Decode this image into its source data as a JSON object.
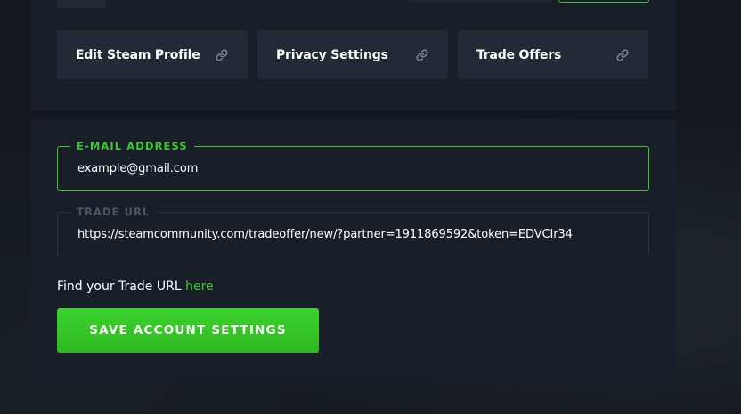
{
  "links": [
    {
      "label": "Edit Steam Profile",
      "icon": "link-icon"
    },
    {
      "label": "Privacy Settings",
      "icon": "link-icon"
    },
    {
      "label": "Trade Offers",
      "icon": "link-icon"
    }
  ],
  "email": {
    "label": "E-MAIL ADDRESS",
    "value": "example@gmail.com"
  },
  "trade_url": {
    "label": "TRADE URL",
    "value": "https://steamcommunity.com/tradeoffer/new/?partner=1911869592&token=EDVCIr34"
  },
  "hint": {
    "text": "Find your Trade URL ",
    "link": "here"
  },
  "save_button": {
    "label": "SAVE ACCOUNT SETTINGS"
  },
  "colors": {
    "background": "#14181e",
    "panel": "#1a1f27",
    "card": "#242a35",
    "accent": "#3cc92f",
    "text": "#ffffff",
    "muted": "#4d5666"
  }
}
